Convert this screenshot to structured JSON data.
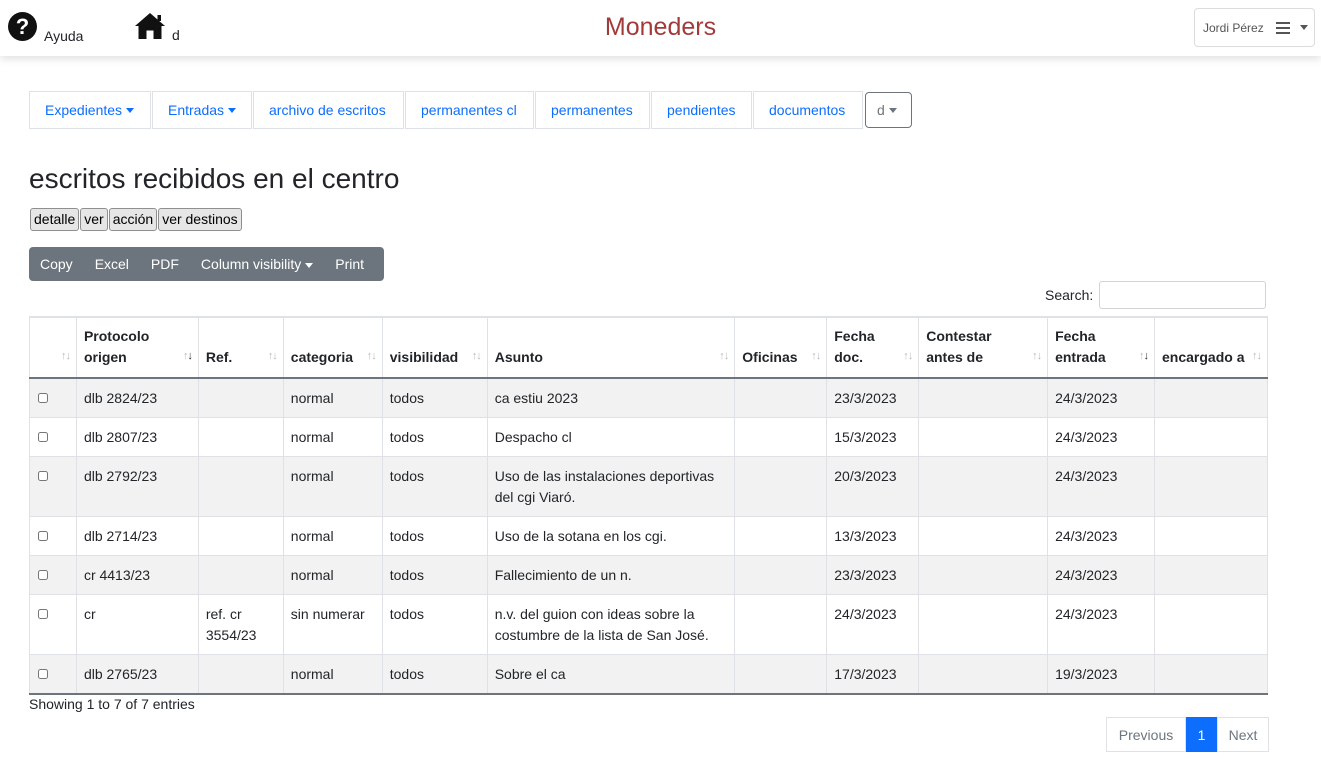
{
  "header": {
    "help_label": "Ayuda",
    "home_label": "d",
    "app_title": "Moneders",
    "user_name": "Jordi Pérez"
  },
  "nav": {
    "tabs": [
      {
        "label": "Expedientes",
        "dropdown": true
      },
      {
        "label": "Entradas",
        "dropdown": true
      },
      {
        "label": "archivo de escritos",
        "dropdown": false
      },
      {
        "label": "permanentes cl",
        "dropdown": false
      },
      {
        "label": "permanentes",
        "dropdown": false
      },
      {
        "label": "pendientes",
        "dropdown": false
      },
      {
        "label": "documentos",
        "dropdown": false
      },
      {
        "label": "d",
        "dropdown": true
      }
    ]
  },
  "page": {
    "title": "escritos recibidos en el centro",
    "actions": [
      "detalle",
      "ver",
      "acción",
      "ver destinos"
    ]
  },
  "export": {
    "buttons": [
      "Copy",
      "Excel",
      "PDF",
      "Column visibility",
      "Print"
    ]
  },
  "search": {
    "label": "Search:",
    "value": ""
  },
  "table": {
    "columns": [
      "",
      "Protocolo origen",
      "Ref.",
      "categoria",
      "visibilidad",
      "Asunto",
      "Oficinas",
      "Fecha doc.",
      "Contestar antes de",
      "Fecha entrada",
      "encargado a"
    ],
    "sorted_column": "Fecha entrada",
    "rows": [
      [
        "",
        "dlb 2824/23",
        "",
        "normal",
        "todos",
        "ca estiu 2023",
        "",
        "23/3/2023",
        "",
        "24/3/2023",
        ""
      ],
      [
        "",
        "dlb 2807/23",
        "",
        "normal",
        "todos",
        "Despacho cl",
        "",
        "15/3/2023",
        "",
        "24/3/2023",
        ""
      ],
      [
        "",
        "dlb 2792/23",
        "",
        "normal",
        "todos",
        "Uso de las instalaciones deportivas del cgi Viaró.",
        "",
        "20/3/2023",
        "",
        "24/3/2023",
        ""
      ],
      [
        "",
        "dlb 2714/23",
        "",
        "normal",
        "todos",
        "Uso de la sotana en los cgi.",
        "",
        "13/3/2023",
        "",
        "24/3/2023",
        ""
      ],
      [
        "",
        "cr 4413/23",
        "",
        "normal",
        "todos",
        "Fallecimiento de un n.",
        "",
        "23/3/2023",
        "",
        "24/3/2023",
        ""
      ],
      [
        "",
        "cr",
        "ref. cr 3554/23",
        "sin numerar",
        "todos",
        "n.v. del guion con ideas sobre la costumbre de la lista de San José.",
        "",
        "24/3/2023",
        "",
        "24/3/2023",
        ""
      ],
      [
        "",
        "dlb 2765/23",
        "",
        "normal",
        "todos",
        "Sobre el ca",
        "",
        "17/3/2023",
        "",
        "19/3/2023",
        ""
      ]
    ]
  },
  "footer": {
    "info": "Showing 1 to 7 of 7 entries",
    "previous": "Previous",
    "current_page": "1",
    "next": "Next"
  },
  "colors": {
    "title": "#a33a3a",
    "link": "#0d6efd",
    "toolbar": "#6c757d",
    "active_page": "#0d6efd",
    "striped_row": "#f2f2f2"
  },
  "icons": [
    "question-circle-icon",
    "home-icon",
    "hamburger-icon",
    "sort-icon"
  ]
}
